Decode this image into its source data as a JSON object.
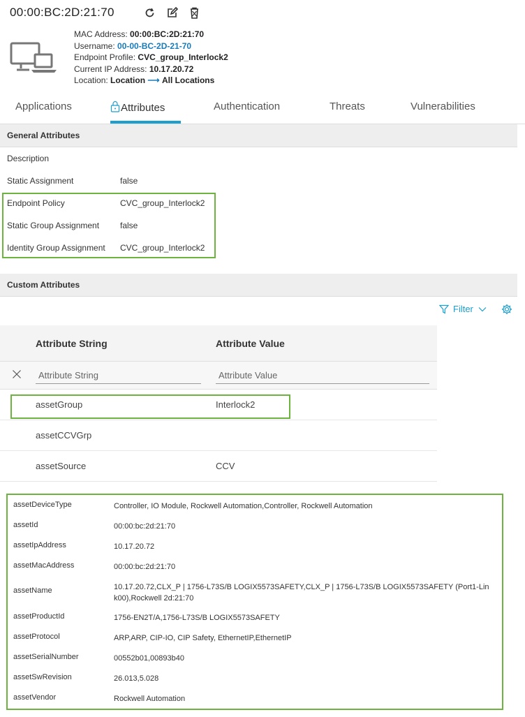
{
  "header": {
    "title": "00:00:BC:2D:21:70",
    "icons": [
      "refresh-icon",
      "edit-icon",
      "delete-icon"
    ]
  },
  "summary": {
    "mac_label": "MAC Address:",
    "mac_value": "00:00:BC:2D:21:70",
    "username_label": "Username:",
    "username_value": "00-00-BC-2D-21-70",
    "profile_label": "Endpoint Profile:",
    "profile_value": "CVC_group_Interlock2",
    "ip_label": "Current IP Address:",
    "ip_value": "10.17.20.72",
    "location_label": "Location:",
    "location_value": "Location",
    "location_arrow": "⟶",
    "location_target": "All Locations"
  },
  "tabs": [
    {
      "label": "Applications"
    },
    {
      "label": "Attributes",
      "active": true
    },
    {
      "label": "Authentication"
    },
    {
      "label": "Threats"
    },
    {
      "label": "Vulnerabilities"
    }
  ],
  "general": {
    "title": "General Attributes",
    "rows": [
      {
        "key": "Description",
        "value": ""
      },
      {
        "key": "Static Assignment",
        "value": "false"
      },
      {
        "key": "Endpoint Policy",
        "value": "CVC_group_Interlock2"
      },
      {
        "key": "Static Group Assignment",
        "value": "false"
      },
      {
        "key": "Identity Group Assignment",
        "value": "CVC_group_Interlock2"
      }
    ]
  },
  "custom": {
    "title": "Custom Attributes",
    "filter_label": "Filter",
    "col_string": "Attribute String",
    "col_value": "Attribute Value",
    "filter_string_placeholder": "Attribute String",
    "filter_value_placeholder": "Attribute Value",
    "rows": [
      {
        "key": "assetGroup",
        "value": "Interlock2"
      },
      {
        "key": "assetCCVGrp",
        "value": ""
      },
      {
        "key": "assetSource",
        "value": "CCV"
      }
    ]
  },
  "assets": [
    {
      "key": "assetDeviceType",
      "value": "Controller, IO Module, Rockwell Automation,Controller, Rockwell Automation"
    },
    {
      "key": "assetId",
      "value": "00:00:bc:2d:21:70"
    },
    {
      "key": "assetIpAddress",
      "value": "10.17.20.72"
    },
    {
      "key": "assetMacAddress",
      "value": "00:00:bc:2d:21:70"
    },
    {
      "key": "assetName",
      "value": "10.17.20.72,CLX_P | 1756-L73S/B LOGIX5573SAFETY,CLX_P | 1756-L73S/B LOGIX5573SAFETY (Port1-Lin k00),Rockwell 2d:21:70"
    },
    {
      "key": "assetProductId",
      "value": "1756-EN2T/A,1756-L73S/B LOGIX5573SAFETY"
    },
    {
      "key": "assetProtocol",
      "value": "ARP,ARP, CIP-IO, CIP Safety, EthernetIP,EthernetIP"
    },
    {
      "key": "assetSerialNumber",
      "value": "00552b01,00893b40"
    },
    {
      "key": "assetSwRevision",
      "value": "26.013,5.028"
    },
    {
      "key": "assetVendor",
      "value": "Rockwell Automation"
    }
  ],
  "colors": {
    "accent": "#1a9fcf",
    "link": "#1a7bb9",
    "highlight_border": "#6cb33f"
  }
}
